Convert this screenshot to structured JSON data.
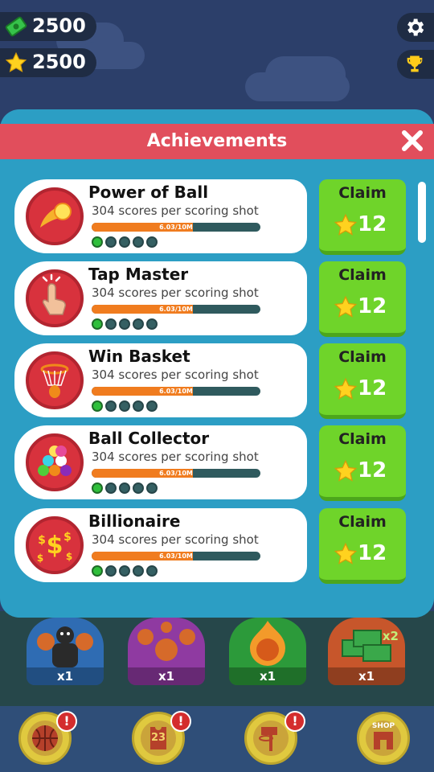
{
  "currency": {
    "cash": "2500",
    "stars": "2500"
  },
  "modal": {
    "title": "Achievements"
  },
  "achievements": [
    {
      "title": "Power of Ball",
      "desc": "304 scores per scoring shot",
      "progress_text": "6.03/10M",
      "progress": 0.6,
      "level": 5,
      "claim_label": "Claim",
      "reward": "12",
      "icon": "fireball-icon"
    },
    {
      "title": "Tap Master",
      "desc": "304 scores per scoring shot",
      "progress_text": "6.03/10M",
      "progress": 0.6,
      "level": 5,
      "claim_label": "Claim",
      "reward": "12",
      "icon": "tap-finger-icon"
    },
    {
      "title": "Win Basket",
      "desc": "304 scores per scoring shot",
      "progress_text": "6.03/10M",
      "progress": 0.6,
      "level": 5,
      "claim_label": "Claim",
      "reward": "12",
      "icon": "basket-hoop-icon"
    },
    {
      "title": "Ball Collector",
      "desc": "304 scores per scoring shot",
      "progress_text": "6.03/10M",
      "progress": 0.6,
      "level": 5,
      "claim_label": "Claim",
      "reward": "12",
      "icon": "colored-balls-icon"
    },
    {
      "title": "Billionaire",
      "desc": "304 scores per scoring shot",
      "progress_text": "6.03/10M",
      "progress": 0.6,
      "level": 5,
      "claim_label": "Claim",
      "reward": "12",
      "icon": "dollar-signs-icon"
    }
  ],
  "dots_filled": 1,
  "powerups": [
    {
      "count": "x1",
      "icon": "strongman-icon",
      "color": "#2f6cb3"
    },
    {
      "count": "x1",
      "icon": "multi-ball-icon",
      "color": "#8f3aa1"
    },
    {
      "count": "x1",
      "icon": "fire-ball-icon",
      "color": "#2c9a3a"
    },
    {
      "count": "x1",
      "icon": "cash-stack-icon",
      "color": "#c7562b",
      "multiplier": "x2"
    }
  ],
  "nav": [
    {
      "icon": "basketball-icon",
      "alert": "!"
    },
    {
      "icon": "jersey-icon",
      "jersey_number": "23",
      "alert": "!"
    },
    {
      "icon": "hoop-icon",
      "alert": "!"
    },
    {
      "icon": "shop-icon",
      "label": "SHOP"
    }
  ],
  "colors": {
    "header": "#e14e5c",
    "modal": "#2c9ec4",
    "claim": "#6fd42a",
    "progress": "#f07c1f"
  }
}
